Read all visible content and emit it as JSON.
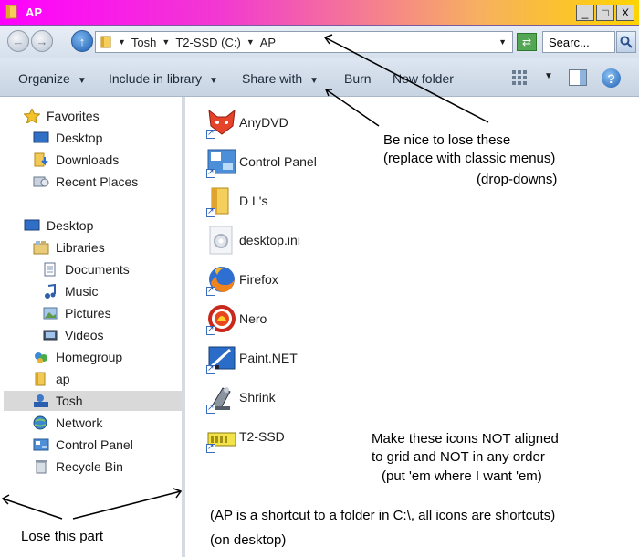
{
  "window": {
    "title": "AP",
    "buttons": [
      "_",
      "□",
      "X"
    ]
  },
  "address": {
    "path": [
      "Tosh",
      "T2-SSD (C:)",
      "AP"
    ],
    "search_placeholder": "Searc..."
  },
  "toolbar": {
    "organize": "Organize",
    "include": "Include in library",
    "share": "Share with",
    "burn": "Burn",
    "new_folder": "New folder",
    "help": "?"
  },
  "nav": {
    "favorites": "Favorites",
    "fav_items": [
      "Desktop",
      "Downloads",
      "Recent Places"
    ],
    "desktop": "Desktop",
    "libraries": "Libraries",
    "lib_items": [
      "Documents",
      "Music",
      "Pictures",
      "Videos"
    ],
    "homegroup": "Homegroup",
    "ap": "ap",
    "tosh": "Tosh",
    "network": "Network",
    "control_panel": "Control Panel",
    "recycle_bin": "Recycle Bin"
  },
  "files": [
    "AnyDVD",
    "Control Panel",
    "D L's",
    "desktop.ini",
    "Firefox",
    "Nero",
    "Paint.NET",
    "Shrink",
    "T2-SSD"
  ],
  "annotations": {
    "top_1": "Be nice to lose these",
    "top_2": "(replace with classic menus)",
    "top_3": "(drop-downs)",
    "mid_1": "Make these icons NOT aligned",
    "mid_2": "to grid and NOT in any order",
    "mid_3": "(put 'em where I want 'em)",
    "bottom_1": "(AP is a shortcut to a folder in C:\\, all icons are shortcuts)",
    "bottom_2": "(on desktop)",
    "lose": "Lose this part"
  },
  "colors": {
    "title_gradient": [
      "#ff00ff",
      "#ffd400"
    ],
    "selection": "#d9d9d9",
    "toolbar_bg": "#d0dae8"
  }
}
